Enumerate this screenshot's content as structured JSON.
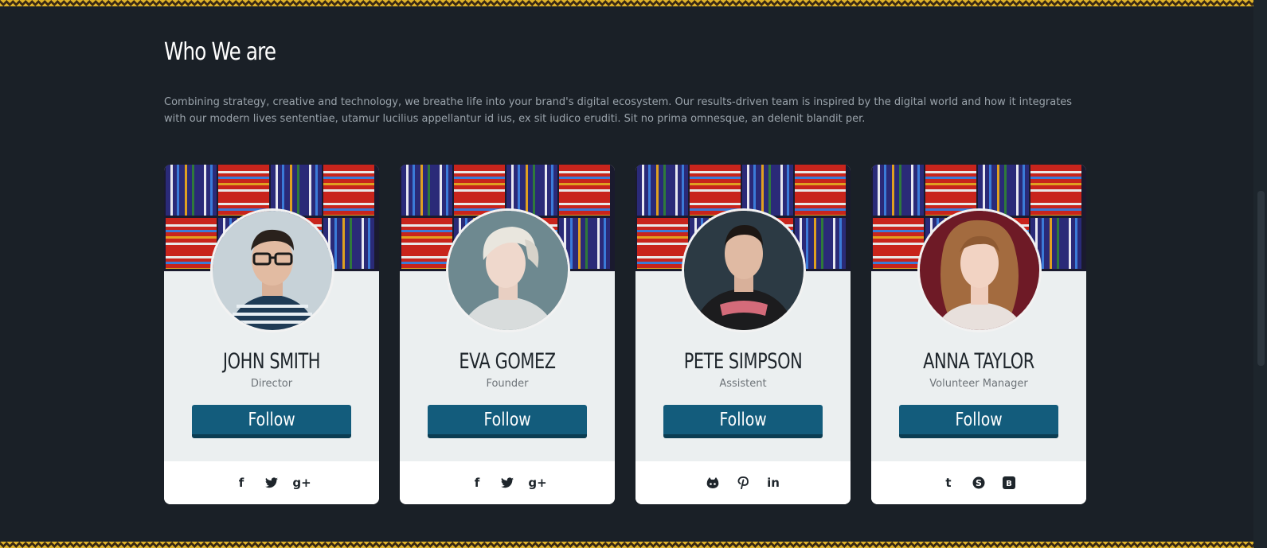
{
  "section": {
    "title": "Who We are",
    "intro": "Combining strategy, creative and technology, we breathe life into your brand's digital ecosystem. Our results-driven team is inspired by the digital world and how it integrates with our modern lives sententiae, utamur lucilius appellantur id ius, ex sit iudico eruditi. Sit no prima omnesque, an delenit blandit per."
  },
  "members": [
    {
      "name": "JOHN SMITH",
      "role": "Director",
      "follow_label": "Follow",
      "social": [
        "facebook-icon",
        "twitter-icon",
        "google-plus-icon"
      ]
    },
    {
      "name": "EVA GOMEZ",
      "role": "Founder",
      "follow_label": "Follow",
      "social": [
        "facebook-icon",
        "twitter-icon",
        "google-plus-icon"
      ]
    },
    {
      "name": "PETE SIMPSON",
      "role": "Assistent",
      "follow_label": "Follow",
      "social": [
        "github-icon",
        "pinterest-icon",
        "linkedin-icon"
      ]
    },
    {
      "name": "ANNA TAYLOR",
      "role": "Volunteer Manager",
      "follow_label": "Follow",
      "social": [
        "tumblr-icon",
        "skype-icon",
        "blogger-icon"
      ]
    }
  ],
  "colors": {
    "background": "#1a2027",
    "card": "#ebeff0",
    "button": "#135c7c",
    "accent_zigzag": "#e0b42a"
  }
}
